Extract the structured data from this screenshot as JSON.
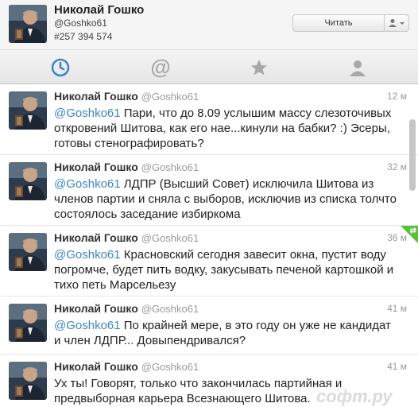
{
  "profile": {
    "name": "Николай Гошко",
    "handle": "@Goshko61",
    "id_text": "#257 394 574",
    "follow_label": "Читать",
    "avatar_icon": "user-avatar-icon"
  },
  "tabs": [
    {
      "name": "timeline",
      "icon": "clock-icon",
      "active": true
    },
    {
      "name": "mentions",
      "icon": "at-icon",
      "active": false
    },
    {
      "name": "favorites",
      "icon": "star-icon",
      "active": false
    },
    {
      "name": "profile",
      "icon": "person-icon",
      "active": false
    }
  ],
  "colors": {
    "accent": "#3a86c6",
    "mention": "#3a86c6",
    "retweet_flag": "#5cbf3a"
  },
  "tweets": [
    {
      "name": "Николай Гошко",
      "handle": "@Goshko61",
      "time": "12 м",
      "mention": "@Goshko61",
      "text": " Пари, что до 8.09 услышим массу слезоточивых откровений Шитова, как его нае...кинули на бабки? :) Эсеры, готовы стенографировать?"
    },
    {
      "name": "Николай Гошко",
      "handle": "@Goshko61",
      "time": "32 м",
      "mention": "@Goshko61",
      "text": " ЛДПР (Высший Совет) исключила Шитова из членов партии и сняла с выборов, исключив из списка толчто состоялось заседание избиркома"
    },
    {
      "name": "Николай Гошко",
      "handle": "@Goshko61",
      "time": "36 м",
      "mention": "@Goshko61",
      "text": " Красновский сегодня завесит окна, пустит воду погромче, будет пить водку, закусывать печеной картошкой и тихо петь Марсельезу"
    },
    {
      "name": "Николай Гошко",
      "handle": "@Goshko61",
      "time": "41 м",
      "mention": "@Goshko61",
      "text": " По крайней мере, в это году он уже не кандидат и член ЛДПР... Довыпендривался?"
    },
    {
      "name": "Николай Гошко",
      "handle": "@Goshko61",
      "time": "41 м",
      "mention": "",
      "text": "Ух ты! Говорят, только что закончилась партийная и предвыборная карьера Всезнающего Шитова."
    }
  ],
  "watermark": "софт.ру"
}
